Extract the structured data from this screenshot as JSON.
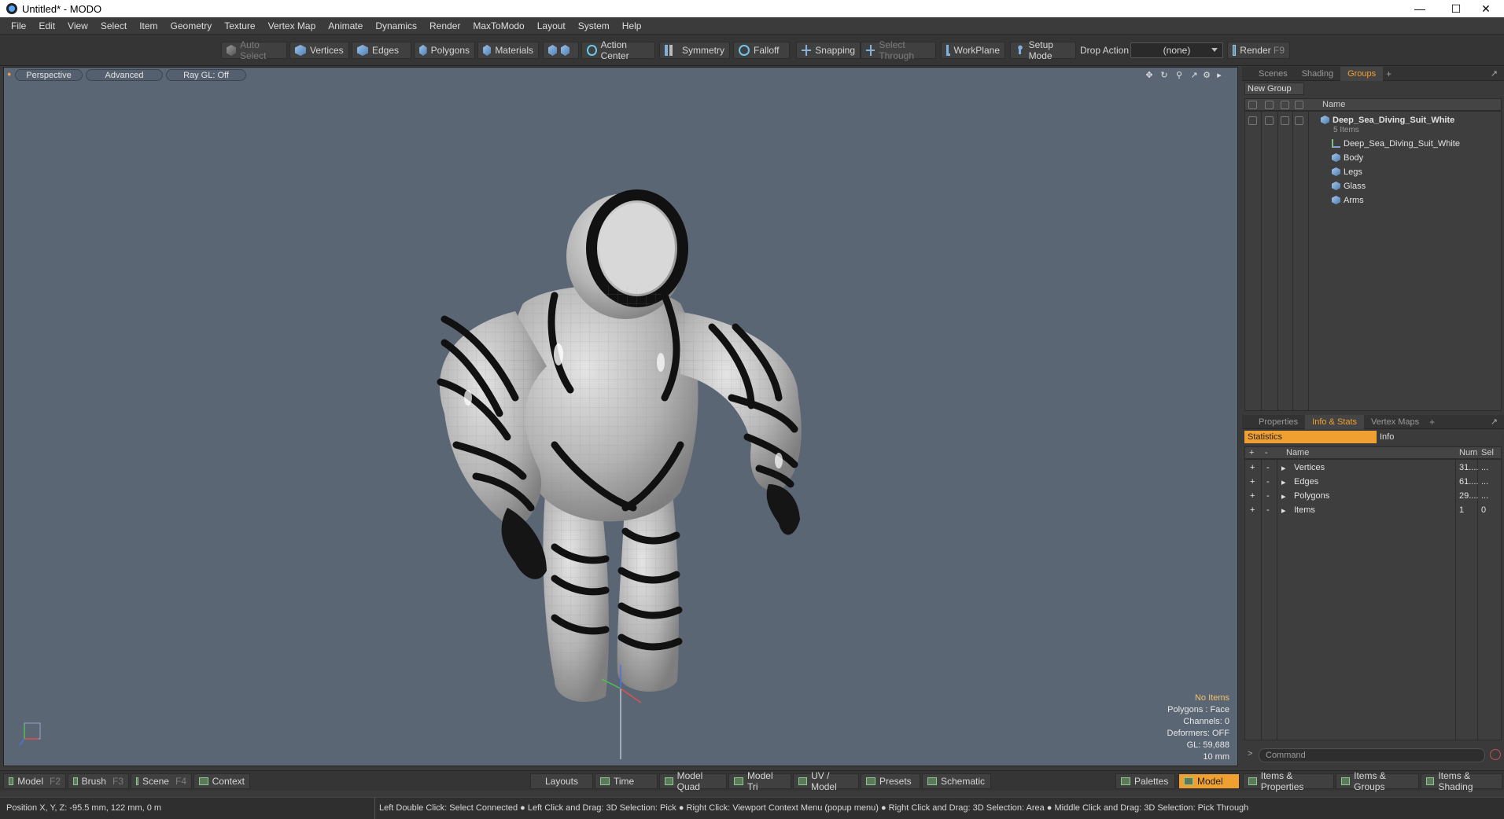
{
  "window": {
    "title": "Untitled* - MODO",
    "controls": [
      "minimize-icon",
      "maximize-icon",
      "close-icon"
    ]
  },
  "menu": [
    "File",
    "Edit",
    "View",
    "Select",
    "Item",
    "Geometry",
    "Texture",
    "Vertex Map",
    "Animate",
    "Dynamics",
    "Render",
    "MaxToModo",
    "Layout",
    "System",
    "Help"
  ],
  "toolbar": {
    "auto_select": "Auto Select",
    "vertices": "Vertices",
    "edges": "Edges",
    "polygons": "Polygons",
    "materials": "Materials",
    "action_center": "Action Center",
    "symmetry": "Symmetry",
    "falloff": "Falloff",
    "snapping": "Snapping",
    "select_through": "Select Through",
    "workplane": "WorkPlane",
    "setup_mode": "Setup Mode",
    "drop_action_label": "Drop Action",
    "drop_action_value": "(none)",
    "render": "Render",
    "render_key": "F9"
  },
  "viewport": {
    "view_mode": "Perspective",
    "shading": "Advanced",
    "raygl": "Ray GL: Off",
    "stats": {
      "selection": "No Items",
      "polygons": "Polygons : Face",
      "channels": "Channels: 0",
      "deformers": "Deformers: OFF",
      "gl": "GL: 59,688",
      "grid": "10 mm"
    }
  },
  "scene_panel": {
    "tabs": [
      "Scenes",
      "Shading",
      "Groups"
    ],
    "active_tab": "Groups",
    "new_group": "New Group",
    "name_header": "Name",
    "group": {
      "name": "Deep_Sea_Diving_Suit_White",
      "count": "5 Items",
      "children": [
        "Deep_Sea_Diving_Suit_White",
        "Body",
        "Legs",
        "Glass",
        "Arms"
      ]
    }
  },
  "stats_panel": {
    "tabs": [
      "Properties",
      "Info & Stats",
      "Vertex Maps"
    ],
    "active_tab": "Info & Stats",
    "sub_tabs": [
      "Statistics",
      "Info"
    ],
    "columns": [
      "Name",
      "Num",
      "Sel"
    ],
    "rows": [
      {
        "name": "Vertices",
        "num": "31....",
        "sel": "..."
      },
      {
        "name": "Edges",
        "num": "61....",
        "sel": "..."
      },
      {
        "name": "Polygons",
        "num": "29....",
        "sel": "..."
      },
      {
        "name": "Items",
        "num": "1",
        "sel": "0"
      }
    ],
    "command_placeholder": "Command"
  },
  "layoutbar": {
    "model": "Model",
    "model_key": "F2",
    "brush": "Brush",
    "brush_key": "F3",
    "scene": "Scene",
    "scene_key": "F4",
    "context": "Context",
    "layouts": "Layouts",
    "time": "Time",
    "model_quad": "Model Quad",
    "model_tri": "Model Tri",
    "uv_model": "UV / Model",
    "presets": "Presets",
    "schematic": "Schematic",
    "palettes": "Palettes",
    "model_active": "Model",
    "items_properties": "Items & Properties",
    "items_groups": "Items & Groups",
    "items_shading": "Items & Shading"
  },
  "status": {
    "position": "Position X, Y, Z:   -95.5 mm, 122 mm, 0 m",
    "hint": "Left Double Click: Select Connected ● Left Click and Drag: 3D Selection: Pick ● Right Click: Viewport Context Menu (popup menu) ● Right Click and Drag: 3D Selection: Area ● Middle Click and Drag: 3D Selection: Pick Through"
  },
  "colors": {
    "accent": "#f0a030",
    "viewport_bg": "#5a6674",
    "panel_bg": "#3a3a3a"
  }
}
